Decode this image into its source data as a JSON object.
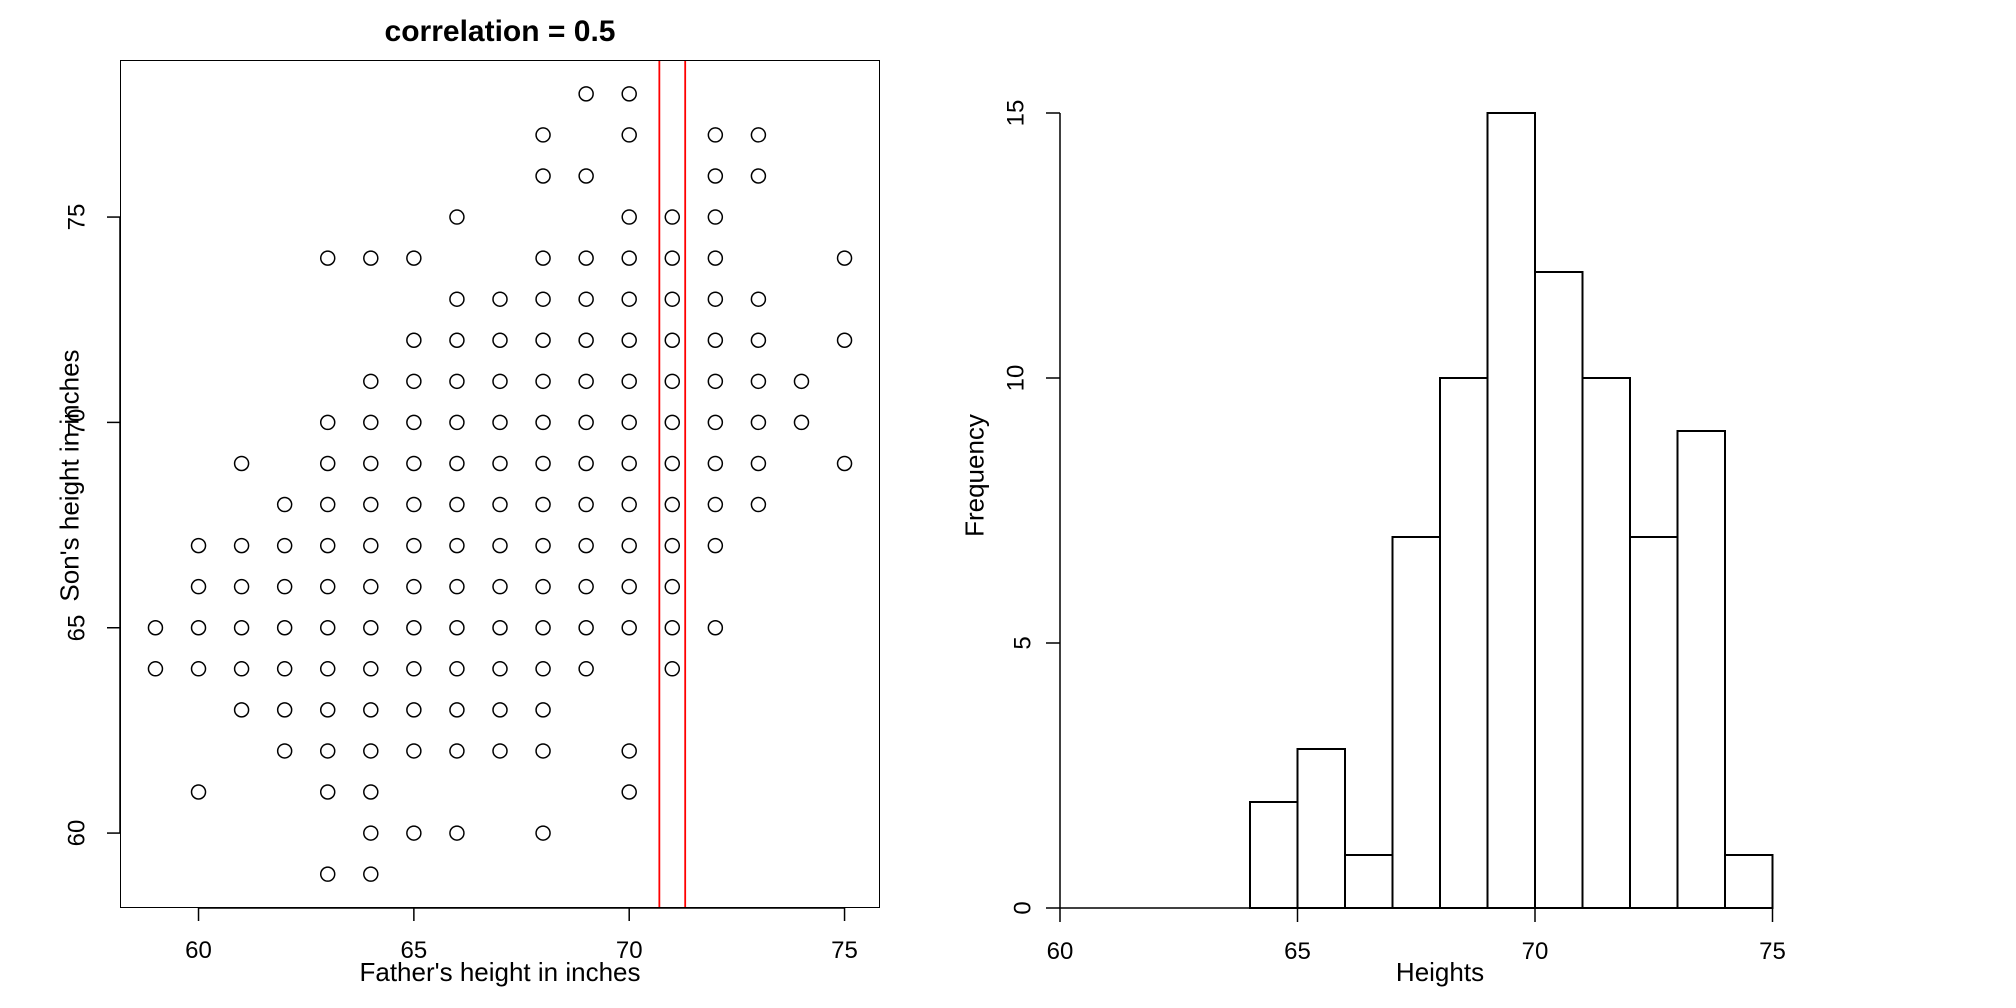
{
  "chart_data": [
    {
      "type": "scatter",
      "title": "correlation = 0.5",
      "xlabel": "Father's height in inches",
      "ylabel": "Son's height in inches",
      "xlim": [
        58.2,
        75.8
      ],
      "ylim": [
        58.2,
        78.8
      ],
      "xticks": [
        60,
        65,
        70,
        75
      ],
      "yticks": [
        60,
        65,
        70,
        75
      ],
      "vlines": [
        70.7,
        71.3
      ],
      "points": [
        [
          59,
          64
        ],
        [
          59,
          65
        ],
        [
          60,
          61
        ],
        [
          60,
          64
        ],
        [
          60,
          65
        ],
        [
          60,
          66
        ],
        [
          60,
          67
        ],
        [
          61,
          63
        ],
        [
          61,
          64
        ],
        [
          61,
          65
        ],
        [
          61,
          66
        ],
        [
          61,
          67
        ],
        [
          61,
          69
        ],
        [
          62,
          62
        ],
        [
          62,
          63
        ],
        [
          62,
          64
        ],
        [
          62,
          65
        ],
        [
          62,
          66
        ],
        [
          62,
          67
        ],
        [
          62,
          68
        ],
        [
          63,
          59
        ],
        [
          63,
          61
        ],
        [
          63,
          62
        ],
        [
          63,
          63
        ],
        [
          63,
          64
        ],
        [
          63,
          65
        ],
        [
          63,
          66
        ],
        [
          63,
          67
        ],
        [
          63,
          68
        ],
        [
          63,
          69
        ],
        [
          63,
          70
        ],
        [
          63,
          74
        ],
        [
          64,
          59
        ],
        [
          64,
          60
        ],
        [
          64,
          61
        ],
        [
          64,
          62
        ],
        [
          64,
          63
        ],
        [
          64,
          64
        ],
        [
          64,
          65
        ],
        [
          64,
          66
        ],
        [
          64,
          67
        ],
        [
          64,
          68
        ],
        [
          64,
          69
        ],
        [
          64,
          70
        ],
        [
          64,
          71
        ],
        [
          64,
          74
        ],
        [
          65,
          60
        ],
        [
          65,
          62
        ],
        [
          65,
          63
        ],
        [
          65,
          64
        ],
        [
          65,
          65
        ],
        [
          65,
          66
        ],
        [
          65,
          67
        ],
        [
          65,
          68
        ],
        [
          65,
          69
        ],
        [
          65,
          70
        ],
        [
          65,
          71
        ],
        [
          65,
          72
        ],
        [
          65,
          74
        ],
        [
          66,
          60
        ],
        [
          66,
          62
        ],
        [
          66,
          63
        ],
        [
          66,
          64
        ],
        [
          66,
          65
        ],
        [
          66,
          66
        ],
        [
          66,
          67
        ],
        [
          66,
          68
        ],
        [
          66,
          69
        ],
        [
          66,
          70
        ],
        [
          66,
          71
        ],
        [
          66,
          72
        ],
        [
          66,
          73
        ],
        [
          66,
          75
        ],
        [
          67,
          62
        ],
        [
          67,
          63
        ],
        [
          67,
          64
        ],
        [
          67,
          65
        ],
        [
          67,
          66
        ],
        [
          67,
          67
        ],
        [
          67,
          68
        ],
        [
          67,
          69
        ],
        [
          67,
          70
        ],
        [
          67,
          71
        ],
        [
          67,
          72
        ],
        [
          67,
          73
        ],
        [
          68,
          60
        ],
        [
          68,
          62
        ],
        [
          68,
          63
        ],
        [
          68,
          64
        ],
        [
          68,
          65
        ],
        [
          68,
          66
        ],
        [
          68,
          67
        ],
        [
          68,
          68
        ],
        [
          68,
          69
        ],
        [
          68,
          70
        ],
        [
          68,
          71
        ],
        [
          68,
          72
        ],
        [
          68,
          73
        ],
        [
          68,
          74
        ],
        [
          68,
          76
        ],
        [
          68,
          77
        ],
        [
          69,
          64
        ],
        [
          69,
          65
        ],
        [
          69,
          66
        ],
        [
          69,
          67
        ],
        [
          69,
          68
        ],
        [
          69,
          69
        ],
        [
          69,
          70
        ],
        [
          69,
          71
        ],
        [
          69,
          72
        ],
        [
          69,
          73
        ],
        [
          69,
          74
        ],
        [
          69,
          76
        ],
        [
          69,
          78
        ],
        [
          70,
          61
        ],
        [
          70,
          62
        ],
        [
          70,
          65
        ],
        [
          70,
          66
        ],
        [
          70,
          67
        ],
        [
          70,
          68
        ],
        [
          70,
          69
        ],
        [
          70,
          70
        ],
        [
          70,
          71
        ],
        [
          70,
          72
        ],
        [
          70,
          73
        ],
        [
          70,
          74
        ],
        [
          70,
          75
        ],
        [
          70,
          77
        ],
        [
          70,
          78
        ],
        [
          71,
          64
        ],
        [
          71,
          65
        ],
        [
          71,
          66
        ],
        [
          71,
          67
        ],
        [
          71,
          68
        ],
        [
          71,
          69
        ],
        [
          71,
          70
        ],
        [
          71,
          71
        ],
        [
          71,
          72
        ],
        [
          71,
          73
        ],
        [
          71,
          74
        ],
        [
          71,
          75
        ],
        [
          72,
          65
        ],
        [
          72,
          67
        ],
        [
          72,
          68
        ],
        [
          72,
          69
        ],
        [
          72,
          70
        ],
        [
          72,
          71
        ],
        [
          72,
          72
        ],
        [
          72,
          73
        ],
        [
          72,
          74
        ],
        [
          72,
          75
        ],
        [
          72,
          76
        ],
        [
          72,
          77
        ],
        [
          73,
          68
        ],
        [
          73,
          69
        ],
        [
          73,
          70
        ],
        [
          73,
          71
        ],
        [
          73,
          72
        ],
        [
          73,
          73
        ],
        [
          73,
          76
        ],
        [
          73,
          77
        ],
        [
          74,
          70
        ],
        [
          74,
          71
        ],
        [
          75,
          69
        ],
        [
          75,
          72
        ],
        [
          75,
          74
        ]
      ]
    },
    {
      "type": "bar",
      "title": "",
      "xlabel": "Heights",
      "ylabel": "Frequency",
      "xlim": [
        60,
        76
      ],
      "ylim": [
        0,
        16
      ],
      "xticks": [
        60,
        65,
        70,
        75
      ],
      "yticks": [
        0,
        5,
        10,
        15
      ],
      "bins": [
        {
          "x0": 64,
          "x1": 65,
          "y": 2
        },
        {
          "x0": 65,
          "x1": 66,
          "y": 3
        },
        {
          "x0": 66,
          "x1": 67,
          "y": 1
        },
        {
          "x0": 67,
          "x1": 68,
          "y": 7
        },
        {
          "x0": 68,
          "x1": 69,
          "y": 10
        },
        {
          "x0": 69,
          "x1": 70,
          "y": 15
        },
        {
          "x0": 70,
          "x1": 71,
          "y": 12
        },
        {
          "x0": 71,
          "x1": 72,
          "y": 10
        },
        {
          "x0": 72,
          "x1": 73,
          "y": 7
        },
        {
          "x0": 73,
          "x1": 74,
          "y": 9
        },
        {
          "x0": 74,
          "x1": 75,
          "y": 1
        }
      ]
    }
  ]
}
